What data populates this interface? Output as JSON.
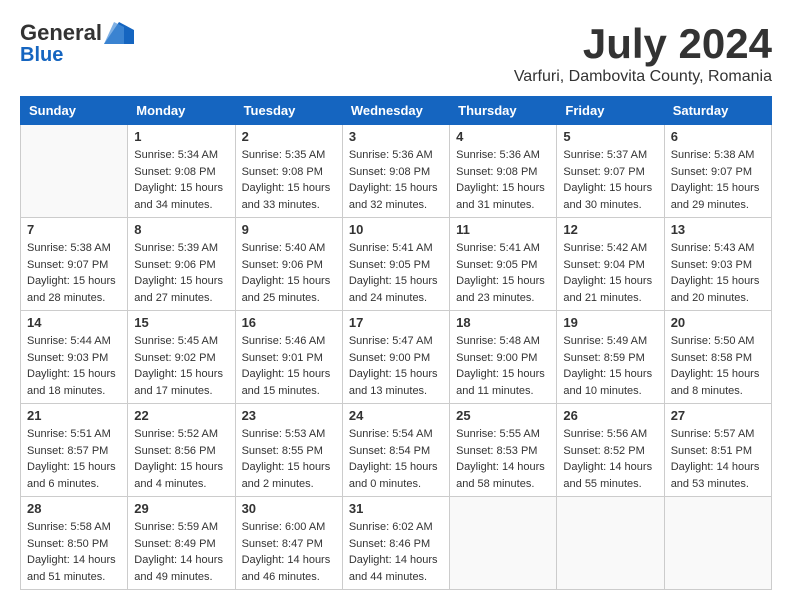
{
  "logo": {
    "general": "General",
    "blue": "Blue"
  },
  "title": "July 2024",
  "subtitle": "Varfuri, Dambovita County, Romania",
  "days_of_week": [
    "Sunday",
    "Monday",
    "Tuesday",
    "Wednesday",
    "Thursday",
    "Friday",
    "Saturday"
  ],
  "weeks": [
    [
      {
        "day": "",
        "sunrise": "",
        "sunset": "",
        "daylight": ""
      },
      {
        "day": "1",
        "sunrise": "Sunrise: 5:34 AM",
        "sunset": "Sunset: 9:08 PM",
        "daylight": "Daylight: 15 hours and 34 minutes."
      },
      {
        "day": "2",
        "sunrise": "Sunrise: 5:35 AM",
        "sunset": "Sunset: 9:08 PM",
        "daylight": "Daylight: 15 hours and 33 minutes."
      },
      {
        "day": "3",
        "sunrise": "Sunrise: 5:36 AM",
        "sunset": "Sunset: 9:08 PM",
        "daylight": "Daylight: 15 hours and 32 minutes."
      },
      {
        "day": "4",
        "sunrise": "Sunrise: 5:36 AM",
        "sunset": "Sunset: 9:08 PM",
        "daylight": "Daylight: 15 hours and 31 minutes."
      },
      {
        "day": "5",
        "sunrise": "Sunrise: 5:37 AM",
        "sunset": "Sunset: 9:07 PM",
        "daylight": "Daylight: 15 hours and 30 minutes."
      },
      {
        "day": "6",
        "sunrise": "Sunrise: 5:38 AM",
        "sunset": "Sunset: 9:07 PM",
        "daylight": "Daylight: 15 hours and 29 minutes."
      }
    ],
    [
      {
        "day": "7",
        "sunrise": "Sunrise: 5:38 AM",
        "sunset": "Sunset: 9:07 PM",
        "daylight": "Daylight: 15 hours and 28 minutes."
      },
      {
        "day": "8",
        "sunrise": "Sunrise: 5:39 AM",
        "sunset": "Sunset: 9:06 PM",
        "daylight": "Daylight: 15 hours and 27 minutes."
      },
      {
        "day": "9",
        "sunrise": "Sunrise: 5:40 AM",
        "sunset": "Sunset: 9:06 PM",
        "daylight": "Daylight: 15 hours and 25 minutes."
      },
      {
        "day": "10",
        "sunrise": "Sunrise: 5:41 AM",
        "sunset": "Sunset: 9:05 PM",
        "daylight": "Daylight: 15 hours and 24 minutes."
      },
      {
        "day": "11",
        "sunrise": "Sunrise: 5:41 AM",
        "sunset": "Sunset: 9:05 PM",
        "daylight": "Daylight: 15 hours and 23 minutes."
      },
      {
        "day": "12",
        "sunrise": "Sunrise: 5:42 AM",
        "sunset": "Sunset: 9:04 PM",
        "daylight": "Daylight: 15 hours and 21 minutes."
      },
      {
        "day": "13",
        "sunrise": "Sunrise: 5:43 AM",
        "sunset": "Sunset: 9:03 PM",
        "daylight": "Daylight: 15 hours and 20 minutes."
      }
    ],
    [
      {
        "day": "14",
        "sunrise": "Sunrise: 5:44 AM",
        "sunset": "Sunset: 9:03 PM",
        "daylight": "Daylight: 15 hours and 18 minutes."
      },
      {
        "day": "15",
        "sunrise": "Sunrise: 5:45 AM",
        "sunset": "Sunset: 9:02 PM",
        "daylight": "Daylight: 15 hours and 17 minutes."
      },
      {
        "day": "16",
        "sunrise": "Sunrise: 5:46 AM",
        "sunset": "Sunset: 9:01 PM",
        "daylight": "Daylight: 15 hours and 15 minutes."
      },
      {
        "day": "17",
        "sunrise": "Sunrise: 5:47 AM",
        "sunset": "Sunset: 9:00 PM",
        "daylight": "Daylight: 15 hours and 13 minutes."
      },
      {
        "day": "18",
        "sunrise": "Sunrise: 5:48 AM",
        "sunset": "Sunset: 9:00 PM",
        "daylight": "Daylight: 15 hours and 11 minutes."
      },
      {
        "day": "19",
        "sunrise": "Sunrise: 5:49 AM",
        "sunset": "Sunset: 8:59 PM",
        "daylight": "Daylight: 15 hours and 10 minutes."
      },
      {
        "day": "20",
        "sunrise": "Sunrise: 5:50 AM",
        "sunset": "Sunset: 8:58 PM",
        "daylight": "Daylight: 15 hours and 8 minutes."
      }
    ],
    [
      {
        "day": "21",
        "sunrise": "Sunrise: 5:51 AM",
        "sunset": "Sunset: 8:57 PM",
        "daylight": "Daylight: 15 hours and 6 minutes."
      },
      {
        "day": "22",
        "sunrise": "Sunrise: 5:52 AM",
        "sunset": "Sunset: 8:56 PM",
        "daylight": "Daylight: 15 hours and 4 minutes."
      },
      {
        "day": "23",
        "sunrise": "Sunrise: 5:53 AM",
        "sunset": "Sunset: 8:55 PM",
        "daylight": "Daylight: 15 hours and 2 minutes."
      },
      {
        "day": "24",
        "sunrise": "Sunrise: 5:54 AM",
        "sunset": "Sunset: 8:54 PM",
        "daylight": "Daylight: 15 hours and 0 minutes."
      },
      {
        "day": "25",
        "sunrise": "Sunrise: 5:55 AM",
        "sunset": "Sunset: 8:53 PM",
        "daylight": "Daylight: 14 hours and 58 minutes."
      },
      {
        "day": "26",
        "sunrise": "Sunrise: 5:56 AM",
        "sunset": "Sunset: 8:52 PM",
        "daylight": "Daylight: 14 hours and 55 minutes."
      },
      {
        "day": "27",
        "sunrise": "Sunrise: 5:57 AM",
        "sunset": "Sunset: 8:51 PM",
        "daylight": "Daylight: 14 hours and 53 minutes."
      }
    ],
    [
      {
        "day": "28",
        "sunrise": "Sunrise: 5:58 AM",
        "sunset": "Sunset: 8:50 PM",
        "daylight": "Daylight: 14 hours and 51 minutes."
      },
      {
        "day": "29",
        "sunrise": "Sunrise: 5:59 AM",
        "sunset": "Sunset: 8:49 PM",
        "daylight": "Daylight: 14 hours and 49 minutes."
      },
      {
        "day": "30",
        "sunrise": "Sunrise: 6:00 AM",
        "sunset": "Sunset: 8:47 PM",
        "daylight": "Daylight: 14 hours and 46 minutes."
      },
      {
        "day": "31",
        "sunrise": "Sunrise: 6:02 AM",
        "sunset": "Sunset: 8:46 PM",
        "daylight": "Daylight: 14 hours and 44 minutes."
      },
      {
        "day": "",
        "sunrise": "",
        "sunset": "",
        "daylight": ""
      },
      {
        "day": "",
        "sunrise": "",
        "sunset": "",
        "daylight": ""
      },
      {
        "day": "",
        "sunrise": "",
        "sunset": "",
        "daylight": ""
      }
    ]
  ]
}
